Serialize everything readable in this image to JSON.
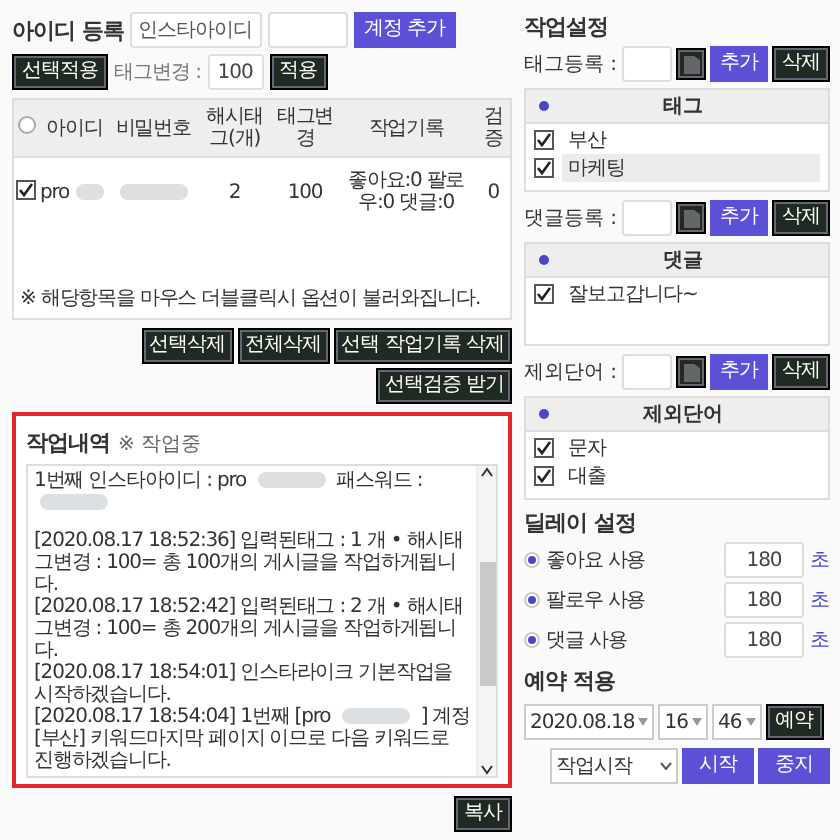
{
  "account_bar": {
    "title": "아이디 등록",
    "id_field": {
      "placeholder": "인스타아이디"
    },
    "add_button": "계정 추가",
    "apply_selected_button": "선택적용",
    "tag_change_label": "태그변경 :",
    "tag_change_value": "100",
    "apply_button": "적용"
  },
  "accounts_table": {
    "select_all": {
      "checked": false
    },
    "columns": [
      "아이디",
      "비밀번호",
      "해시태그(개)",
      "태그변경",
      "작업기록",
      "검증"
    ],
    "rows": [
      {
        "checked": true,
        "cells": [
          {
            "kind": "text_redacted",
            "text": "pro"
          },
          {
            "kind": "redacted"
          },
          {
            "kind": "text",
            "text": "2"
          },
          {
            "kind": "text",
            "text": "100"
          },
          {
            "kind": "text",
            "text": "좋아요:0 팔로우:0 댓글:0"
          },
          {
            "kind": "text",
            "text": "0"
          }
        ]
      }
    ]
  },
  "note": "※ 해당항목을 마우스 더블클릭시 옵션이 불러와집니다.",
  "table_buttons": [
    "선택삭제",
    "전체삭제",
    "선택 작업기록 삭제",
    "선택검증 받기"
  ],
  "log": {
    "title": "작업내역",
    "status": "※ 작업중",
    "lines": [
      {
        "parts": [
          {
            "kind": "text",
            "text": "1번째 인스타아이디 : pro"
          },
          {
            "kind": "redacted"
          },
          {
            "kind": "text",
            "text": "패스워드 :"
          },
          {
            "kind": "redacted"
          }
        ]
      },
      {
        "parts": [
          {
            "kind": "text",
            "text": "[2020.08.17 18:52:36] 입력된태그 : 1 개 • 해시태그변경 : 100= 총 100개의 게시글을 작업하게됩니다."
          }
        ]
      },
      {
        "parts": [
          {
            "kind": "text",
            "text": "[2020.08.17 18:52:42] 입력된태그 : 2 개 • 해시태그변경 : 100= 총 200개의 게시글을 작업하게됩니다."
          }
        ]
      },
      {
        "parts": [
          {
            "kind": "text",
            "text": "[2020.08.17 18:54:01] 인스타라이크 기본작업을 시작하겠습니다."
          }
        ]
      },
      {
        "parts": [
          {
            "kind": "text",
            "text": "[2020.08.17 18:54:04] 1번째 [pro"
          },
          {
            "kind": "redacted"
          },
          {
            "kind": "text",
            "text": "] 계정 [부산] 키워드마지막 페이지 이므로 다음 키워드로 진행하겠습니다."
          }
        ]
      }
    ]
  },
  "copy_button": "복사",
  "settings": {
    "title": "작업설정",
    "sections": [
      {
        "label": "태그등록 :",
        "add_button": "추가",
        "delete_button": "삭제",
        "header": "태그",
        "items": [
          {
            "text": "부산",
            "checked": true,
            "selected": false
          },
          {
            "text": "마케팅",
            "checked": true,
            "selected": true
          }
        ]
      },
      {
        "label": "댓글등록 :",
        "add_button": "추가",
        "delete_button": "삭제",
        "header": "댓글",
        "items": [
          {
            "text": "잘보고갑니다~",
            "checked": true,
            "selected": false
          }
        ]
      },
      {
        "label": "제외단어 :",
        "add_button": "추가",
        "delete_button": "삭제",
        "header": "제외단어",
        "items": [
          {
            "text": "문자",
            "checked": true,
            "selected": false
          },
          {
            "text": "대출",
            "checked": true,
            "selected": false
          }
        ]
      }
    ]
  },
  "delay": {
    "title": "딜레이 설정",
    "rows": [
      {
        "label": "좋아요 사용",
        "on": true,
        "value": "180",
        "unit": "초"
      },
      {
        "label": "팔로우 사용",
        "on": true,
        "value": "180",
        "unit": "초"
      },
      {
        "label": "댓글 사용",
        "on": true,
        "value": "180",
        "unit": "초"
      }
    ]
  },
  "reservation": {
    "title": "예약 적용",
    "date": "2020.08.18",
    "hour": "16",
    "minute": "46",
    "button": "예약",
    "mode": "작업시작",
    "start_button": "시작",
    "stop_button": "중지"
  }
}
